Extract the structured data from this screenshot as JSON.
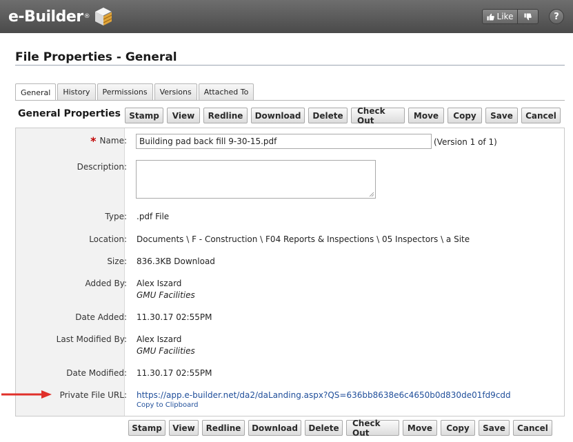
{
  "app": {
    "logo_text": "e-Builder",
    "logo_reg": "®"
  },
  "header": {
    "like_label": "Like",
    "help_label": "?"
  },
  "page": {
    "title": "File Properties - General",
    "section_title": "General Properties"
  },
  "tabs": [
    {
      "label": "General",
      "active": true
    },
    {
      "label": "History"
    },
    {
      "label": "Permissions"
    },
    {
      "label": "Versions"
    },
    {
      "label": "Attached To"
    }
  ],
  "actions": {
    "stamp": "Stamp",
    "view": "View",
    "redline": "Redline",
    "download": "Download",
    "delete": "Delete",
    "check_out": "Check Out",
    "move": "Move",
    "copy": "Copy",
    "save": "Save",
    "cancel": "Cancel"
  },
  "fields": {
    "name": {
      "label": "Name:",
      "required_mark": "*",
      "value": "Building pad back fill 9-30-15.pdf",
      "version_note": "(Version 1 of 1)"
    },
    "description": {
      "label": "Description:",
      "value": ""
    },
    "type": {
      "label": "Type:",
      "value": ".pdf File"
    },
    "location": {
      "label": "Location:",
      "value": "Documents \\ F - Construction \\ F04 Reports & Inspections \\ 05 Inspectors \\ a Site"
    },
    "size": {
      "label": "Size:",
      "value": "836.3KB Download"
    },
    "added_by": {
      "label": "Added By:",
      "name": "Alex Iszard",
      "org": "GMU Facilities"
    },
    "date_added": {
      "label": "Date Added:",
      "value": "11.30.17 02:55PM"
    },
    "last_modified_by": {
      "label": "Last Modified By:",
      "name": "Alex Iszard",
      "org": "GMU Facilities"
    },
    "date_modified": {
      "label": "Date Modified:",
      "value": "11.30.17 02:55PM"
    },
    "private_url": {
      "label": "Private File URL:",
      "value": "https://app.e-builder.net/da2/daLanding.aspx?QS=636bb8638e6c4650b0d830de01fd9cdd",
      "copy_label": "Copy to Clipboard"
    }
  },
  "colors": {
    "header_bg": "#555555",
    "accent_link": "#1f4e9a",
    "required": "#c00000",
    "arrow": "#e0302a"
  }
}
